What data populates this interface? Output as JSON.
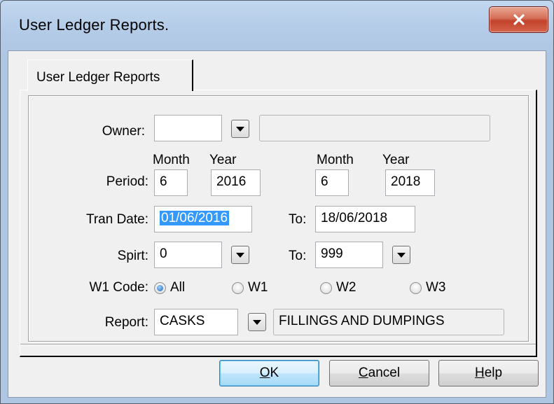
{
  "window": {
    "title": "User Ledger Reports."
  },
  "tabs": [
    {
      "label": "User Ledger Reports"
    }
  ],
  "form": {
    "owner": {
      "label": "Owner:",
      "value": "",
      "description": ""
    },
    "period": {
      "label": "Period:",
      "from": {
        "month_header": "Month",
        "year_header": "Year",
        "month": "6",
        "year": "2016"
      },
      "to": {
        "month_header": "Month",
        "year_header": "Year",
        "month": "6",
        "year": "2018"
      }
    },
    "tran_date": {
      "label": "Tran Date:",
      "from": "01/06/2016",
      "to_label": "To:",
      "to": "18/06/2018"
    },
    "spirit": {
      "label": "Spirt:",
      "from": "0",
      "to_label": "To:",
      "to": "999"
    },
    "w1_code": {
      "label": "W1 Code:",
      "options": [
        "All",
        "W1",
        "W2",
        "W3"
      ],
      "selected": "All"
    },
    "report": {
      "label": "Report:",
      "code": "CASKS",
      "description": "FILLINGS AND DUMPINGS"
    }
  },
  "buttons": {
    "ok": {
      "mnemonic": "O",
      "rest": "K"
    },
    "cancel": {
      "mnemonic": "C",
      "rest": "ancel"
    },
    "help": {
      "mnemonic": "H",
      "rest": "elp"
    }
  },
  "icons": {
    "close": "close-icon",
    "dropdown": "chevron-down-icon"
  }
}
